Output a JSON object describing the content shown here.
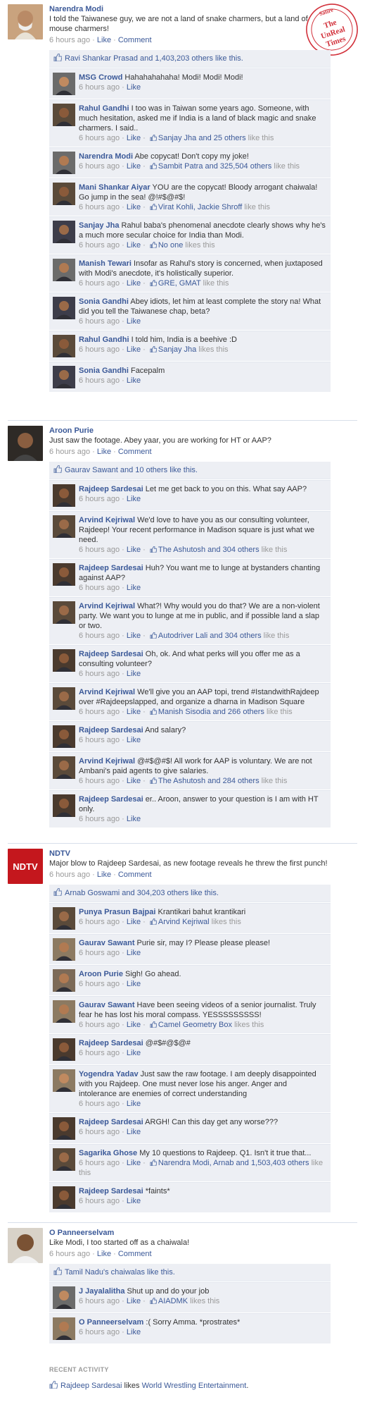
{
  "colors": {
    "link": "#3b5998",
    "comment_bg": "#edeff4",
    "meta": "#999999",
    "stamp": "#d2303a"
  },
  "stamp": {
    "text": [
      "Satire",
      "The",
      "UnReal",
      "Times"
    ]
  },
  "common": {
    "like": "Like",
    "comment": "Comment",
    "sep": " · "
  },
  "posts": [
    {
      "author": "Narendra Modi",
      "text": "I told the Taiwanese guy, we are not a land of snake charmers, but a land of mouse charmers!",
      "time": "6 hours ago",
      "likes": "Ravi Shankar Prasad and 1,403,203 others like this.",
      "comments": [
        {
          "author": "MSG Crowd",
          "text": "Hahahahahaha! Modi! Modi! Modi!",
          "time": "6 hours ago",
          "likes": ""
        },
        {
          "author": "Rahul Gandhi",
          "text": "I too was in Taiwan some years ago. Someone, with much hesitation, asked me if India is a land of black magic and snake charmers. I said..",
          "time": "6 hours ago",
          "likes": "Sanjay Jha and 25 others",
          "likes_suffix": " like this"
        },
        {
          "author": "Narendra Modi",
          "text": "Abe copycat! Don't copy my joke!",
          "time": "6 hours ago",
          "likes": "Sambit Patra and 325,504 others",
          "likes_suffix": " like this"
        },
        {
          "author": "Mani Shankar Aiyar",
          "text": "YOU are the copycat! Bloody arrogant chaiwala! Go jump in the sea! @!#$@#$!",
          "time": "6 hours ago",
          "likes": "Virat Kohli, Jackie Shroff",
          "likes_suffix": " like this"
        },
        {
          "author": "Sanjay Jha",
          "text": "Rahul baba's phenomenal anecdote clearly shows why he's a much more secular choice for India than Modi.",
          "time": "6 hours ago",
          "likes": "No one",
          "likes_suffix": " likes this"
        },
        {
          "author": "Manish Tewari",
          "text": "Insofar as Rahul's story is concerned, when juxtaposed with Modi's anecdote, it's holistically superior.",
          "time": "6 hours ago",
          "likes": "GRE, GMAT",
          "likes_suffix": " like this"
        },
        {
          "author": "Sonia Gandhi",
          "text": "Abey idiots, let him at least complete the story na! What did you tell the Taiwanese chap, beta?",
          "time": "6 hours ago",
          "likes": ""
        },
        {
          "author": "Rahul Gandhi",
          "text": "I told him, India is a beehive :D",
          "time": "6 hours ago",
          "likes": "Sanjay Jha",
          "likes_suffix": " likes this"
        },
        {
          "author": "Sonia Gandhi",
          "text": "Facepalm",
          "time": "6 hours ago",
          "likes": ""
        }
      ]
    },
    {
      "author": "Aroon Purie",
      "text": "Just saw the footage. Abey yaar, you are working for HT or AAP?",
      "time": "6 hours ago",
      "likes": "Gaurav Sawant and 10 others like this.",
      "comments": [
        {
          "author": "Rajdeep Sardesai",
          "text": "Let me get back to you on this. What say AAP?",
          "time": "6 hours ago",
          "likes": ""
        },
        {
          "author": "Arvind Kejriwal",
          "text": "We'd love to have you as our consulting volunteer, Rajdeep! Your recent performance in Madison square is just what we need.",
          "time": "6 hours ago",
          "likes": "The Ashutosh and 304 others",
          "likes_suffix": " like this"
        },
        {
          "author": "Rajdeep Sardesai",
          "text": "Huh? You want me to lunge at bystanders chanting against AAP?",
          "time": "6 hours ago",
          "likes": ""
        },
        {
          "author": "Arvind Kejriwal",
          "text": "What?! Why would you do that? We are a non-violent party. We want you to lunge at me in public, and if possible land a slap or two.",
          "time": "6 hours ago",
          "likes": "Autodriver Lali and 304 others",
          "likes_suffix": " like this"
        },
        {
          "author": "Rajdeep Sardesai",
          "text": "Oh, ok. And what perks will you offer me as a consulting volunteer?",
          "time": "6 hours ago",
          "likes": ""
        },
        {
          "author": "Arvind Kejriwal",
          "text": "We'll give you an AAP topi, trend #IstandwithRajdeep over #Rajdeepslapped, and organize a dharna in Madison Square",
          "time": "6 hours ago",
          "likes": "Manish Sisodia and 266 others",
          "likes_suffix": " like this"
        },
        {
          "author": "Rajdeep Sardesai",
          "text": "And salary?",
          "time": "6 hours ago",
          "likes": ""
        },
        {
          "author": "Arvind Kejriwal",
          "text": "@#$@#$! All work for AAP is voluntary. We are not Ambani's paid agents to give salaries.",
          "time": "6 hours ago",
          "likes": "The Ashutosh and 284 others",
          "likes_suffix": " like this"
        },
        {
          "author": "Rajdeep Sardesai",
          "text": "er.. Aroon, answer to your question is I am with HT only.",
          "time": "6 hours ago",
          "likes": ""
        }
      ]
    },
    {
      "author": "NDTV",
      "text": "Major blow to Rajdeep Sardesai, as new footage reveals he threw the first punch!",
      "time": "6 hours ago",
      "likes": "Arnab Goswami and 304,203 others like this.",
      "comments": [
        {
          "author": "Punya Prasun Bajpai",
          "text": "Krantikari bahut krantikari",
          "time": "6 hours ago",
          "likes": "Arvind Kejriwal",
          "likes_suffix": " likes this"
        },
        {
          "author": "Gaurav Sawant",
          "text": "Purie sir, may I? Please please please!",
          "time": "6 hours ago",
          "likes": ""
        },
        {
          "author": "Aroon Purie",
          "text": "Sigh! Go ahead.",
          "time": "6 hours ago",
          "likes": ""
        },
        {
          "author": "Gaurav Sawant",
          "text": "Have been seeing videos of a senior journalist. Truly fear he has lost his moral compass. YESSSSSSSSS!",
          "time": "6 hours ago",
          "likes": "Camel Geometry Box",
          "likes_suffix": " likes this"
        },
        {
          "author": "Rajdeep Sardesai",
          "text": "@#$#@$@#",
          "time": "6 hours ago",
          "likes": ""
        },
        {
          "author": "Yogendra Yadav",
          "text": "Just saw the raw footage. I am deeply disappointed with you Rajdeep. One must never lose his anger. Anger and intolerance are enemies of correct understanding",
          "time": "6 hours ago",
          "likes": ""
        },
        {
          "author": "Rajdeep Sardesai",
          "text": "ARGH! Can this day get any worse???",
          "time": "6 hours ago",
          "likes": ""
        },
        {
          "author": "Sagarika Ghose",
          "text": "My 10 questions to Rajdeep. Q1. Isn't it true that...",
          "time": "6 hours ago",
          "likes": "Narendra Modi, Arnab and 1,503,403 others",
          "likes_suffix": " like this"
        },
        {
          "author": "Rajdeep Sardesai",
          "text": "*faints*",
          "time": "6 hours ago",
          "likes": ""
        }
      ]
    },
    {
      "author": "O Panneerselvam",
      "text": "Like Modi, I too started off as a chaiwala!",
      "time": "6 hours ago",
      "likes": "Tamil Nadu's chaiwalas like this.",
      "comments": [
        {
          "author": "J Jayalalitha",
          "text": "Shut up and do your job",
          "time": "6 hours ago",
          "likes": "AIADMK",
          "likes_suffix": " likes this"
        },
        {
          "author": "O Panneerselvam",
          "text": ":( Sorry Amma. *prostrates*",
          "time": "6 hours ago",
          "likes": ""
        }
      ]
    }
  ],
  "recent_activity": {
    "title": "RECENT ACTIVITY",
    "actor": "Rajdeep Sardesai",
    "verb": " likes ",
    "object": "World Wrestling Entertainment",
    "end": "."
  },
  "ndtv_logo": "NDTV"
}
